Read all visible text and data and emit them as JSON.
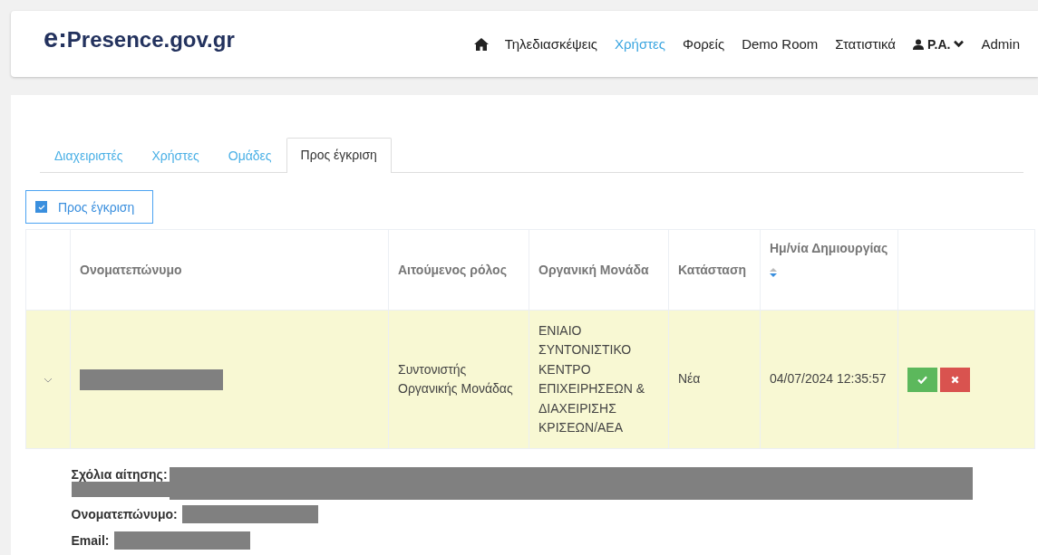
{
  "header": {
    "logo_prefix": "e:",
    "logo_rest": "Presence.gov.gr",
    "nav": [
      {
        "label": "Τηλεδιασκέψεις",
        "selected": false
      },
      {
        "label": "Χρήστες",
        "selected": true
      },
      {
        "label": "Φορείς",
        "selected": false
      },
      {
        "label": "Demo Room",
        "selected": false
      },
      {
        "label": "Στατιστικά",
        "selected": false
      }
    ],
    "user_menu": "P.A.",
    "admin": "Admin"
  },
  "tabs": [
    {
      "label": "Διαχειριστές",
      "selected": false
    },
    {
      "label": "Χρήστες",
      "selected": false
    },
    {
      "label": "Ομάδες",
      "selected": false
    },
    {
      "label": "Προς έγκριση",
      "selected": true
    }
  ],
  "filter": {
    "label": "Προς έγκριση",
    "checked": true
  },
  "table": {
    "columns": [
      "Ονοματεπώνυμο",
      "Αιτούμενος ρόλος",
      "Οργανική Μονάδα",
      "Κατάσταση",
      "Ημ/νία Δημιουργίας"
    ],
    "rows": [
      {
        "expanded": true,
        "name_redacted": true,
        "role": "Συντονιστής Οργανικής Μονάδας",
        "unit": "ΕΝΙΑΙΟ ΣΥΝΤΟΝΙΣΤΙΚΟ ΚΕΝΤΡΟ ΕΠΙΧΕΙΡΗΣΕΩΝ & ΔΙΑΧΕΙΡΙΣΗΣ ΚΡΙΣΕΩΝ/ΑΕΑ",
        "status": "Νέα",
        "created": "04/07/2024 12:35:57"
      }
    ]
  },
  "details": [
    {
      "label": "Σχόλια αίτησης:",
      "kind": "long"
    },
    {
      "label": "Ονοματεπώνυμο:",
      "kind": "short"
    },
    {
      "label": "Email:",
      "kind": "short"
    }
  ]
}
